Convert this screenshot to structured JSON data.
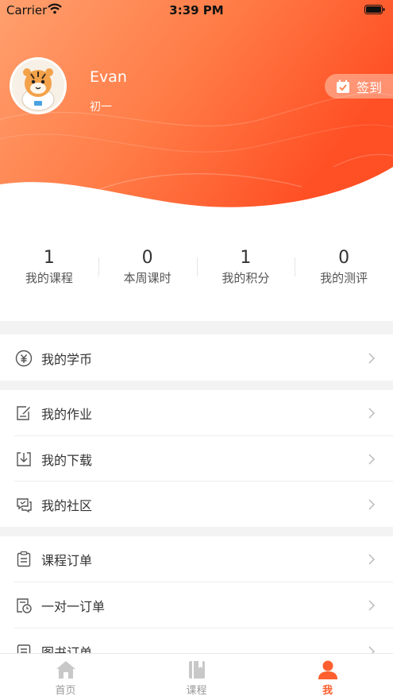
{
  "status_bar": {
    "carrier": "Carrier",
    "time": "3:39 PM"
  },
  "profile": {
    "name": "Evan",
    "grade": "初一",
    "checkin_label": "签到"
  },
  "stats": [
    {
      "value": "1",
      "label": "我的课程"
    },
    {
      "value": "0",
      "label": "本周课时"
    },
    {
      "value": "1",
      "label": "我的积分"
    },
    {
      "value": "0",
      "label": "我的测评"
    }
  ],
  "menu": {
    "coins": "我的学币",
    "homework": "我的作业",
    "downloads": "我的下载",
    "community": "我的社区",
    "course_orders": "课程订单",
    "one_on_one_orders": "一对一订单",
    "book_orders": "图书订单"
  },
  "tabbar": [
    {
      "label": "首页"
    },
    {
      "label": "课程"
    },
    {
      "label": "我"
    }
  ],
  "colors": {
    "accent": "#ff5f2e",
    "header_start": "#ff9a6a",
    "header_end": "#ff4f26"
  }
}
